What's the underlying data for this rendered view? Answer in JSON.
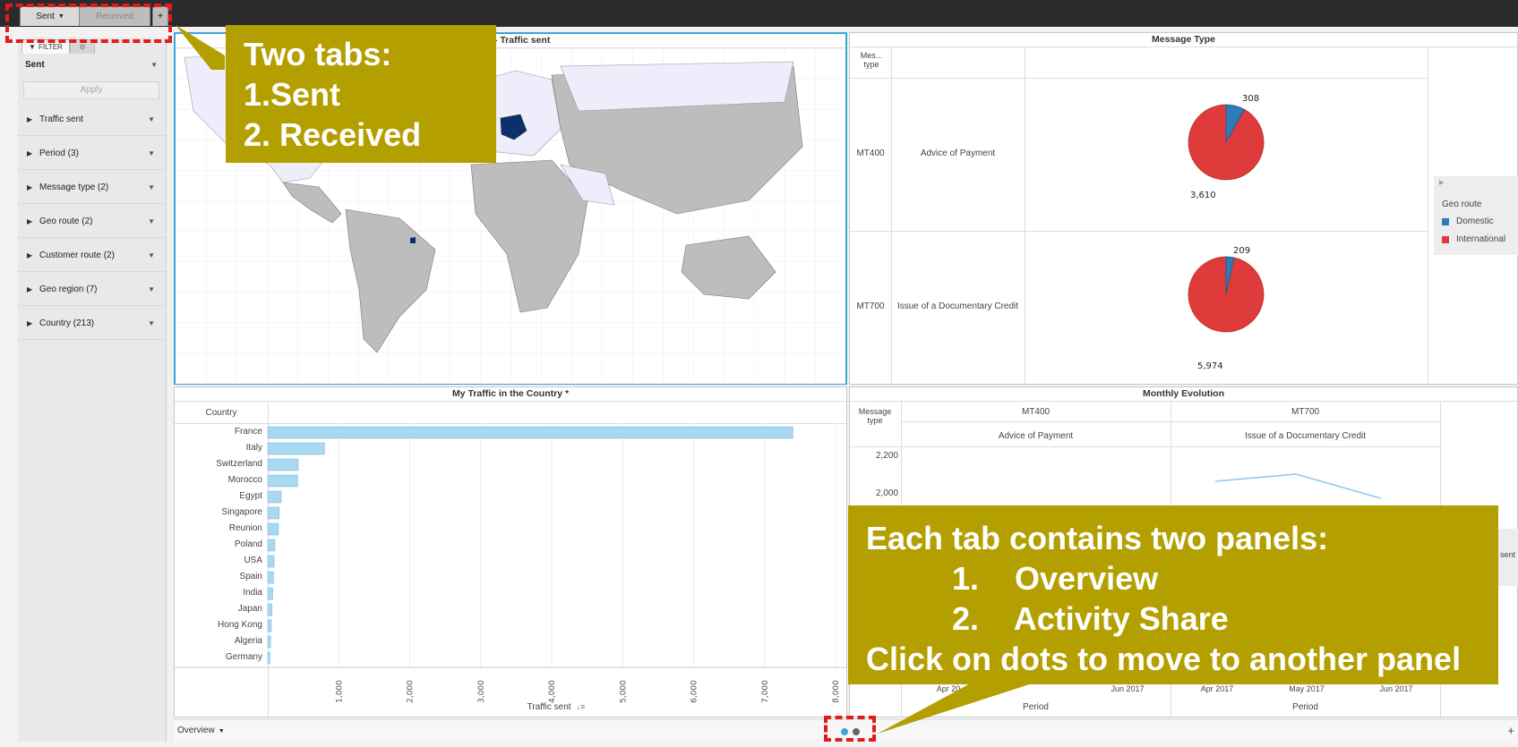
{
  "tabs": {
    "sent": "Sent",
    "received": "Received",
    "add": "+"
  },
  "filter": {
    "tab_label": "FILTER",
    "selected_value": "Sent",
    "apply_label": "Apply",
    "items": [
      {
        "label": "Traffic sent"
      },
      {
        "label": "Period (3)"
      },
      {
        "label": "Message type (2)"
      },
      {
        "label": "Geo route (2)"
      },
      {
        "label": "Customer route (2)"
      },
      {
        "label": "Geo region (7)"
      },
      {
        "label": "Country (213)"
      }
    ]
  },
  "map_panel": {
    "title": "print - Traffic sent"
  },
  "message_type_panel": {
    "title": "Message Type",
    "col_header": "Mes... type",
    "rows": [
      {
        "code": "MT400",
        "name": "Advice of Payment",
        "domestic": 308,
        "international": 3610,
        "domestic_label": "308",
        "international_label": "3,610"
      },
      {
        "code": "MT700",
        "name": "Issue of a Documentary Credit",
        "domestic": 209,
        "international": 5974,
        "domestic_label": "209",
        "international_label": "5,974"
      }
    ],
    "legend": {
      "title": "Geo route",
      "items": [
        {
          "label": "Domestic",
          "color": "#2e7bb7"
        },
        {
          "label": "International",
          "color": "#df3b3b"
        }
      ]
    }
  },
  "country_panel": {
    "title": "My Traffic in the Country *",
    "col_header": "Country",
    "xlabel": "Traffic sent"
  },
  "chart_data": {
    "type": "bar",
    "orientation": "horizontal",
    "categories": [
      "France",
      "Italy",
      "Switzerland",
      "Morocco",
      "Egypt",
      "Singapore",
      "Reunion",
      "Poland",
      "USA",
      "Spain",
      "India",
      "Japan",
      "Hong Kong",
      "Algeria",
      "Germany"
    ],
    "values": [
      7400,
      800,
      430,
      420,
      190,
      160,
      150,
      100,
      90,
      80,
      70,
      60,
      50,
      40,
      30
    ],
    "xlabel": "Traffic sent",
    "xlim": [
      0,
      8000
    ],
    "xticks": [
      "1,000",
      "2,000",
      "3,000",
      "4,000",
      "5,000",
      "6,000",
      "7,000",
      "8,000"
    ],
    "color": "#a8d8f2"
  },
  "monthly_panel": {
    "title": "Monthly Evolution",
    "col_header": "Message type",
    "columns": [
      {
        "code": "MT400",
        "name": "Advice of Payment"
      },
      {
        "code": "MT700",
        "name": "Issue of a Documentary Credit"
      }
    ],
    "yticks": [
      "2,200",
      "2,000"
    ],
    "xticks_left": [
      "Apr 20",
      "Jun 2017"
    ],
    "xticks_right": [
      "Apr 2017",
      "May 2017",
      "Jun 2017"
    ],
    "xlabel": "Period",
    "legend_fragment": "sent"
  },
  "bottom": {
    "panel_selector": "Overview"
  },
  "callouts": {
    "tabs": {
      "line1": "Two tabs:",
      "line2": "1.Sent",
      "line3": "2. Received"
    },
    "panels": {
      "line1": "Each tab contains two panels:",
      "item1": "1.    Overview",
      "item2": "2.    Activity Share",
      "line4": "Click on dots to move to another panel"
    }
  }
}
